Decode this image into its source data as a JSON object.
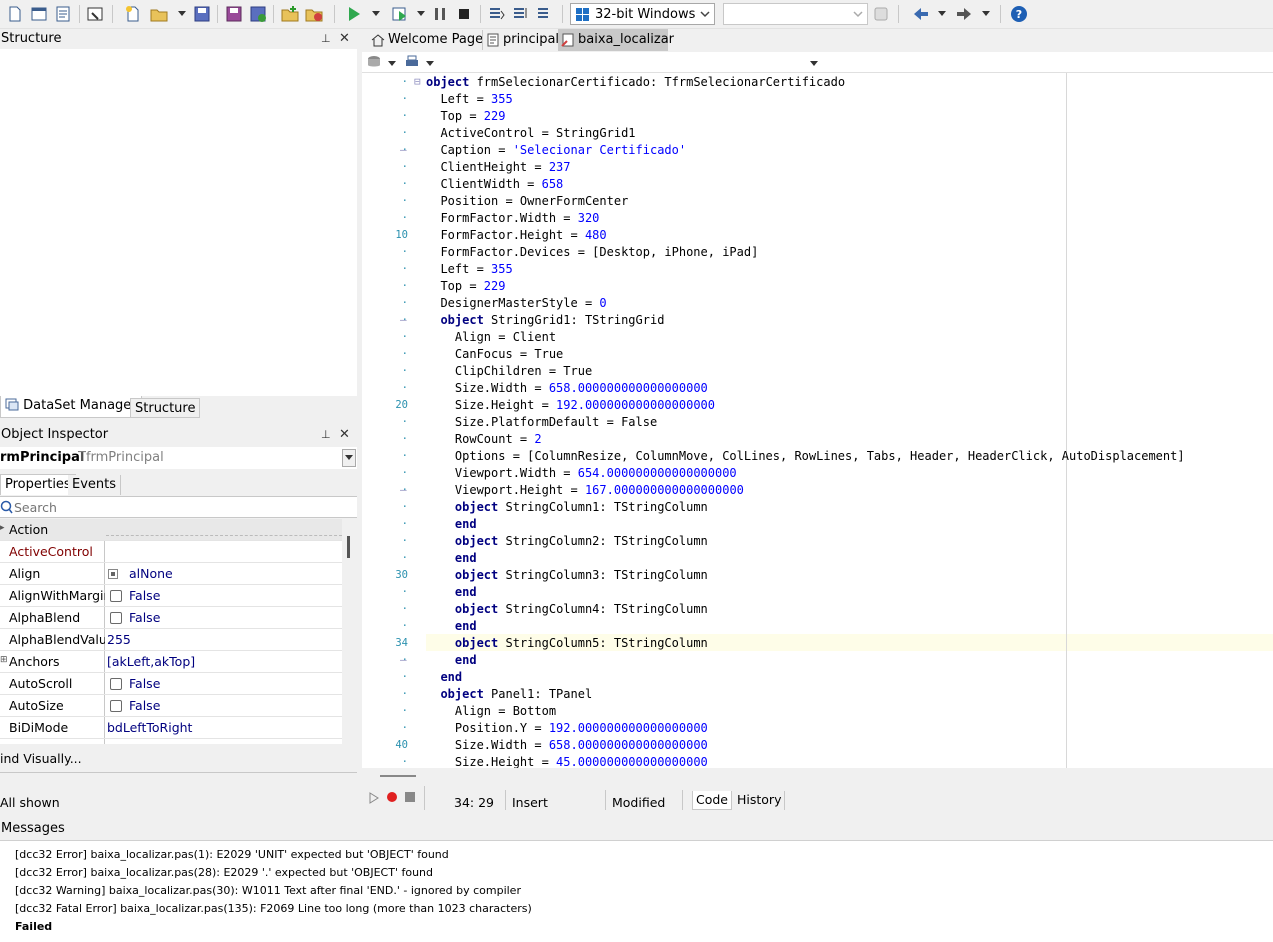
{
  "toolbar": {
    "platform_label": "32-bit Windows"
  },
  "structure_panel": {
    "title": "Structure"
  },
  "bottom_tabs": {
    "dataset_manager": "DataSet Manager",
    "structure": "Structure"
  },
  "object_inspector": {
    "title": "Object Inspector",
    "selected_object": "rmPrincipal",
    "selected_class": "TfrmPrincipal",
    "tabs": [
      "Properties",
      "Events"
    ],
    "search_placeholder": "Search",
    "rows": [
      {
        "name": "Action",
        "value": ""
      },
      {
        "name": "ActiveControl",
        "value": ""
      },
      {
        "name": "Align",
        "value": "alNone"
      },
      {
        "name": "AlignWithMargins",
        "value": "False"
      },
      {
        "name": "AlphaBlend",
        "value": "False"
      },
      {
        "name": "AlphaBlendValue",
        "value": "255"
      },
      {
        "name": "Anchors",
        "value": "[akLeft,akTop]"
      },
      {
        "name": "AutoScroll",
        "value": "False"
      },
      {
        "name": "AutoSize",
        "value": "False"
      },
      {
        "name": "BiDiMode",
        "value": "bdLeftToRight"
      }
    ],
    "find_visually": "ind Visually...",
    "all_shown": "All shown"
  },
  "editor_tabs": [
    "Welcome Page",
    "principal",
    "baixa_localizar"
  ],
  "status": {
    "position": "34: 29",
    "mode": "Insert",
    "state": "Modified",
    "code_tab": "Code",
    "history_tab": "History"
  },
  "code": {
    "line_numbers": [
      "10",
      "20",
      "30",
      "34",
      "40"
    ],
    "lines": [
      "object frmSelecionarCertificado: TfrmSelecionarCertificado",
      "  Left = 355",
      "  Top = 229",
      "  ActiveControl = StringGrid1",
      "  Caption = 'Selecionar Certificado'",
      "  ClientHeight = 237",
      "  ClientWidth = 658",
      "  Position = OwnerFormCenter",
      "  FormFactor.Width = 320",
      "  FormFactor.Height = 480",
      "  FormFactor.Devices = [Desktop, iPhone, iPad]",
      "  Left = 355",
      "  Top = 229",
      "  DesignerMasterStyle = 0",
      "  object StringGrid1: TStringGrid",
      "    Align = Client",
      "    CanFocus = True",
      "    ClipChildren = True",
      "    Size.Width = 658.000000000000000000",
      "    Size.Height = 192.000000000000000000",
      "    Size.PlatformDefault = False",
      "    RowCount = 2",
      "    Options = [ColumnResize, ColumnMove, ColLines, RowLines, Tabs, Header, HeaderClick, AutoDisplacement]",
      "    Viewport.Width = 654.000000000000000000",
      "    Viewport.Height = 167.000000000000000000",
      "    object StringColumn1: TStringColumn",
      "    end",
      "    object StringColumn2: TStringColumn",
      "    end",
      "    object StringColumn3: TStringColumn",
      "    end",
      "    object StringColumn4: TStringColumn",
      "    end",
      "    object StringColumn5: TStringColumn",
      "    end",
      "  end",
      "  object Panel1: TPanel",
      "    Align = Bottom",
      "    Position.Y = 192.000000000000000000",
      "    Size.Width = 658.000000000000000000",
      "    Size.Height = 45.000000000000000000"
    ]
  },
  "messages": {
    "title": "Messages",
    "items": [
      "[dcc32 Error] baixa_localizar.pas(1): E2029 'UNIT' expected but 'OBJECT' found",
      "[dcc32 Error] baixa_localizar.pas(28): E2029 '.' expected but 'OBJECT' found",
      "[dcc32 Warning] baixa_localizar.pas(30): W1011 Text after final 'END.' - ignored by compiler",
      "[dcc32 Fatal Error] baixa_localizar.pas(135): F2069 Line too long (more than 1023 characters)"
    ],
    "failed": "Failed"
  },
  "colors": {
    "keyword": "#000080",
    "number": "#0000ff",
    "line_number": "#2b91af",
    "current_line": "#fefde8"
  }
}
